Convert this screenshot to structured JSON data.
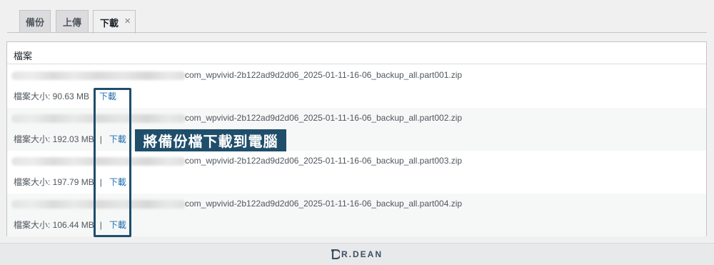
{
  "tabs": [
    {
      "label": "備份"
    },
    {
      "label": "上傳"
    },
    {
      "label": "下載",
      "close": "×"
    }
  ],
  "panel": {
    "header": "檔案"
  },
  "files": [
    {
      "name": "com_wpvivid-2b122ad9d2d06_2025-01-11-16-06_backup_all.part001.zip",
      "size_text": "檔案大小: 90.63 MB",
      "separator": "",
      "download_label": "下載"
    },
    {
      "name": "com_wpvivid-2b122ad9d2d06_2025-01-11-16-06_backup_all.part002.zip",
      "size_text": "檔案大小: 192.03 MB",
      "separator": "|",
      "download_label": "下載"
    },
    {
      "name": "com_wpvivid-2b122ad9d2d06_2025-01-11-16-06_backup_all.part003.zip",
      "size_text": "檔案大小: 197.79 MB",
      "separator": "|",
      "download_label": "下載"
    },
    {
      "name": "com_wpvivid-2b122ad9d2d06_2025-01-11-16-06_backup_all.part004.zip",
      "size_text": "檔案大小: 106.44 MB",
      "separator": "|",
      "download_label": "下載"
    }
  ],
  "annotation": {
    "callout": "將備份檔下載到電腦",
    "color": "#1f4e6b"
  },
  "footer": {
    "brand": "R.DEAN",
    "icon": "dr-dean-logo-icon"
  }
}
